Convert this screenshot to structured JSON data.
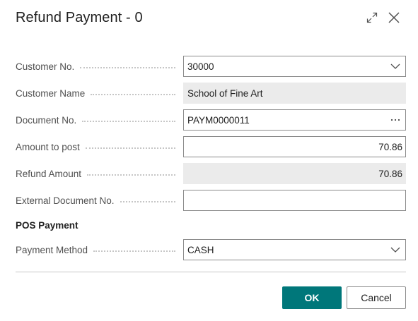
{
  "dialog": {
    "title": "Refund Payment - 0",
    "expand_icon": "expand-icon",
    "close_icon": "close-icon"
  },
  "fields": {
    "customer_no": {
      "label": "Customer No.",
      "value": "30000"
    },
    "customer_name": {
      "label": "Customer Name",
      "value": "School of Fine Art"
    },
    "document_no": {
      "label": "Document No.",
      "value": "PAYM0000011"
    },
    "amount_to_post": {
      "label": "Amount to post",
      "value": "70.86"
    },
    "refund_amount": {
      "label": "Refund Amount",
      "value": "70.86"
    },
    "external_document_no": {
      "label": "External Document No.",
      "value": ""
    }
  },
  "pos_payment": {
    "heading": "POS Payment",
    "payment_method": {
      "label": "Payment Method",
      "value": "CASH"
    }
  },
  "buttons": {
    "ok": "OK",
    "cancel": "Cancel"
  },
  "colors": {
    "primary": "#00777a",
    "readonly_bg": "#ebebeb",
    "border": "#8a8a8a"
  }
}
